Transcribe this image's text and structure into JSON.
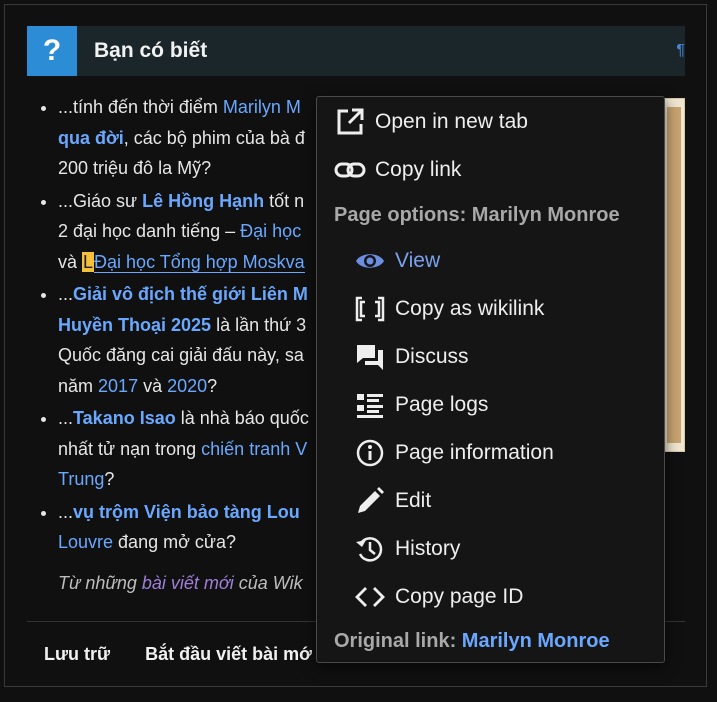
{
  "header": {
    "title": "Bạn có biết",
    "icon": "question-mark",
    "pilcrow": "¶"
  },
  "items": [
    {
      "parts": [
        "...tính đến thời điểm ",
        "Marilyn M",
        "qua đời",
        ", các bộ phim của bà đ",
        "200 triệu đô la Mỹ?"
      ]
    },
    {
      "parts": [
        "...Giáo sư ",
        "Lê Hồng Hạnh",
        " tốt n",
        "2 đại học danh tiếng – ",
        "Đại học",
        "và ",
        "L",
        "Đại học Tổng hợp Moskva"
      ]
    },
    {
      "parts": [
        "...",
        "Giải vô địch thế giới Liên M",
        "Huyền Thoại 2025",
        " là lần thứ 3",
        "Quốc đăng cai giải đấu này, sa",
        "năm ",
        "2017",
        " và ",
        "2020",
        "?"
      ]
    },
    {
      "parts": [
        "...",
        "Takano Isao",
        " là nhà báo quốc",
        "nhất tử nạn trong ",
        "chiến tranh V",
        "Trung",
        "?"
      ]
    },
    {
      "parts": [
        "...",
        "vụ trộm Viện bảo tàng Lou",
        "Louvre",
        " đang mở cửa?"
      ]
    }
  ],
  "note": {
    "prefix": "Từ những ",
    "link": "bài viết mới",
    "suffix": " của Wik"
  },
  "footer": {
    "archive": "Lưu trữ",
    "start": "Bắt đầu viết bài mớ"
  },
  "menu": {
    "open_new_tab": "Open in new tab",
    "copy_link": "Copy link",
    "page_options_label": "Page options: ",
    "page_options_title": "Marilyn Monroe",
    "view": "View",
    "copy_wikilink": "Copy as wikilink",
    "discuss": "Discuss",
    "page_logs": "Page logs",
    "page_information": "Page information",
    "edit": "Edit",
    "history": "History",
    "copy_page_id": "Copy page ID",
    "original_link_label": "Original link: ",
    "original_link_title": "Marilyn Monroe"
  },
  "colors": {
    "accent_blue": "#2d8cd6",
    "link": "#6aa8ff",
    "view_active": "#6b8fe0",
    "highlight": "#f5c13c"
  }
}
